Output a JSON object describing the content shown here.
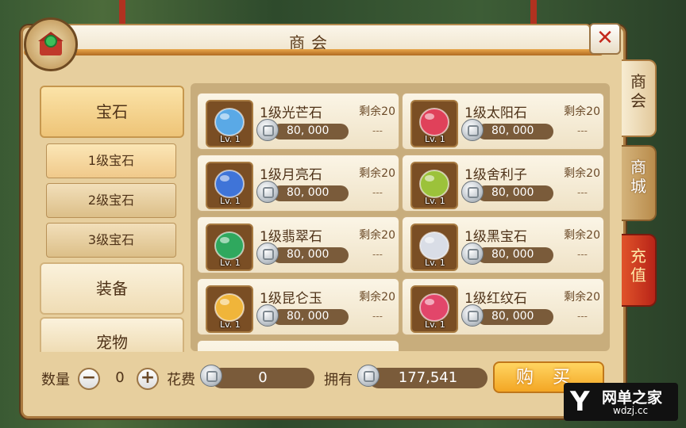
{
  "window": {
    "title": "商会",
    "close_label": "✕"
  },
  "side_tabs": [
    {
      "label": "商会",
      "state": "active"
    },
    {
      "label": "商城",
      "state": "normal"
    },
    {
      "label": "充值",
      "state": "red"
    }
  ],
  "categories": {
    "gem": "宝石",
    "gem_levels": [
      "1级宝石",
      "2级宝石",
      "3级宝石"
    ],
    "equipment": "装备",
    "pet": "宠物"
  },
  "items": [
    {
      "name": "1级光芒石",
      "lv": "Lv. 1",
      "price": "80, 000",
      "remain": "剩余20",
      "dash": "---",
      "icon": "crystal-icon",
      "color": "#5aa9e6"
    },
    {
      "name": "1级太阳石",
      "lv": "Lv. 1",
      "price": "80, 000",
      "remain": "剩余20",
      "dash": "---",
      "icon": "sun-stone-icon",
      "color": "#e0415a"
    },
    {
      "name": "1级月亮石",
      "lv": "Lv. 1",
      "price": "80, 000",
      "remain": "剩余20",
      "dash": "---",
      "icon": "moon-stone-icon",
      "color": "#3f74d8"
    },
    {
      "name": "1级舍利子",
      "lv": "Lv. 1",
      "price": "80, 000",
      "remain": "剩余20",
      "dash": "---",
      "icon": "relic-icon",
      "color": "#9cc23a"
    },
    {
      "name": "1级翡翠石",
      "lv": "Lv. 1",
      "price": "80, 000",
      "remain": "剩余20",
      "dash": "---",
      "icon": "jade-icon",
      "color": "#2fa85e"
    },
    {
      "name": "1级黑宝石",
      "lv": "Lv. 1",
      "price": "80, 000",
      "remain": "剩余20",
      "dash": "---",
      "icon": "black-gem-icon",
      "color": "#d9dde6"
    },
    {
      "name": "1级昆仑玉",
      "lv": "Lv. 1",
      "price": "80, 000",
      "remain": "剩余20",
      "dash": "---",
      "icon": "kunlun-jade-icon",
      "color": "#f0b53a"
    },
    {
      "name": "1级红纹石",
      "lv": "Lv. 1",
      "price": "80, 000",
      "remain": "剩余20",
      "dash": "---",
      "icon": "red-stone-icon",
      "color": "#e2466a"
    }
  ],
  "bottom": {
    "qty_label": "数量",
    "qty_value": "0",
    "minus": "−",
    "plus": "+",
    "cost_label": "花费",
    "cost_value": "0",
    "own_label": "拥有",
    "own_value": "177,541",
    "buy_label": "购买"
  },
  "watermark": {
    "logo": "Y",
    "main": "网单之家",
    "url": "wdzj.cc"
  }
}
